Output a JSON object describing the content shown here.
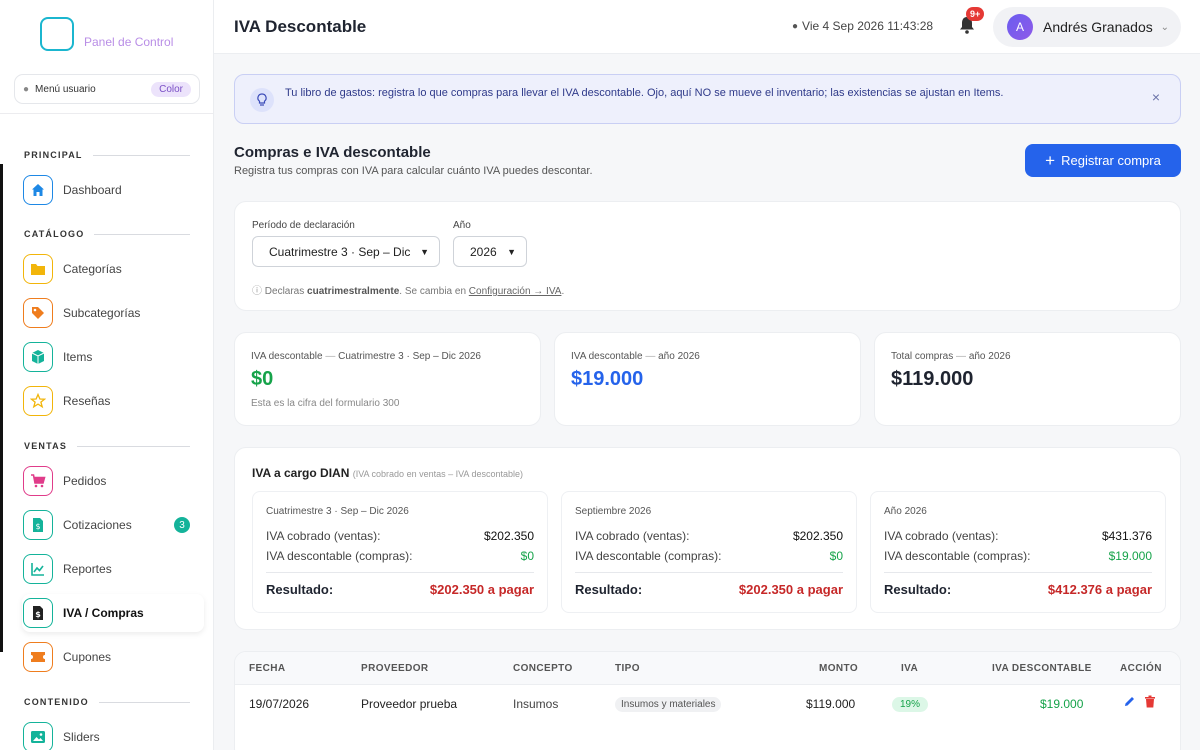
{
  "brand": {
    "text": "Panel de Control"
  },
  "user_menu": {
    "label": "Menú usuario",
    "pill": "Color"
  },
  "sidebar": {
    "sections": {
      "principal": "PRINCIPAL",
      "catalogo": "CATÁLOGO",
      "ventas": "VENTAS",
      "contenido": "CONTENIDO"
    },
    "items": {
      "dashboard": {
        "label": "Dashboard",
        "icon": "home-icon",
        "color": "#1e88e5"
      },
      "categorias": {
        "label": "Categorías",
        "icon": "folder-icon",
        "color": "#f2b50a"
      },
      "subcategorias": {
        "label": "Subcategorías",
        "icon": "tag-icon",
        "color": "#ef7d1e"
      },
      "items": {
        "label": "Items",
        "icon": "cube-icon",
        "color": "#14b39a"
      },
      "resenas": {
        "label": "Reseñas",
        "icon": "star-icon",
        "color": "#f2b50a"
      },
      "pedidos": {
        "label": "Pedidos",
        "icon": "cart-icon",
        "color": "#e03c8a"
      },
      "cotizaciones": {
        "label": "Cotizaciones",
        "icon": "invoice-icon",
        "color": "#14b39a",
        "badge": "3"
      },
      "reportes": {
        "label": "Reportes",
        "icon": "chart-icon",
        "color": "#14b39a"
      },
      "iva_compras": {
        "label": "IVA / Compras",
        "icon": "receipt-icon",
        "color": "#222222"
      },
      "cupones": {
        "label": "Cupones",
        "icon": "ticket-icon",
        "color": "#ef7d1e"
      },
      "sliders": {
        "label": "Sliders",
        "icon": "image-icon",
        "color": "#14b39a"
      }
    }
  },
  "header": {
    "title": "IVA Descontable",
    "datetime": "Vie 4 Sep 2026 11:43:28",
    "notif_badge": "9+",
    "user_initial": "A",
    "user_name": "Andrés Granados"
  },
  "alert": {
    "text": "Tu libro de gastos: registra lo que compras para llevar el IVA descontable. Ojo, aquí NO se mueve el inventario; las existencias se ajustan en Items.",
    "close": "×"
  },
  "section": {
    "title": "Compras e IVA descontable",
    "subtitle": "Registra tus compras con IVA para calcular cuánto IVA puedes descontar.",
    "register_button": "Registrar compra"
  },
  "filters": {
    "period_label": "Período de declaración",
    "period_value": "Cuatrimestre 3 · Sep – Dic",
    "year_label": "Año",
    "year_value": "2026",
    "hint_prefix": "Declaras",
    "hint_bold": "cuatrimestralmente",
    "hint_mid": ". Se cambia en",
    "hint_link": "Configuración → IVA",
    "hint_end": "."
  },
  "stats": [
    {
      "label": "IVA descontable",
      "sep": " — ",
      "label_dim": "Cuatrimestre 3 · Sep – Dic 2026",
      "value": "$0",
      "color": "#16a34a",
      "note": "Esta es la cifra del formulario 300"
    },
    {
      "label": "IVA descontable",
      "sep": " — ",
      "label_dim": "año 2026",
      "value": "$19.000",
      "color": "#2563eb",
      "note": ""
    },
    {
      "label": "Total compras",
      "sep": " — ",
      "label_dim": "año 2026",
      "value": "$119.000",
      "color": "#1f2430",
      "note": ""
    }
  ],
  "dian": {
    "title": "IVA a cargo DIAN",
    "subtitle": "(IVA cobrado en ventas – IVA descontable)",
    "cobrado_label": "IVA cobrado (ventas):",
    "descontable_label": "IVA descontable (compras):",
    "resultado_label": "Resultado:",
    "cards": [
      {
        "title": "Cuatrimestre 3 · Sep – Dic 2026",
        "cobrado": "$202.350",
        "descontable": "$0",
        "resultado": "$202.350 a pagar"
      },
      {
        "title": "Septiembre 2026",
        "cobrado": "$202.350",
        "descontable": "$0",
        "resultado": "$202.350 a pagar"
      },
      {
        "title": "Año 2026",
        "cobrado": "$431.376",
        "descontable": "$19.000",
        "resultado": "$412.376 a pagar"
      }
    ]
  },
  "table": {
    "columns": [
      "FECHA",
      "PROVEEDOR",
      "CONCEPTO",
      "TIPO",
      "MONTO",
      "IVA",
      "IVA DESCONTABLE",
      "ACCIÓN"
    ],
    "rows": [
      {
        "fecha": "19/07/2026",
        "proveedor": "Proveedor prueba",
        "concepto": "Insumos",
        "tipo": "Insumos y materiales",
        "monto": "$119.000",
        "iva": "19%",
        "iva_descontable": "$19.000"
      }
    ]
  }
}
